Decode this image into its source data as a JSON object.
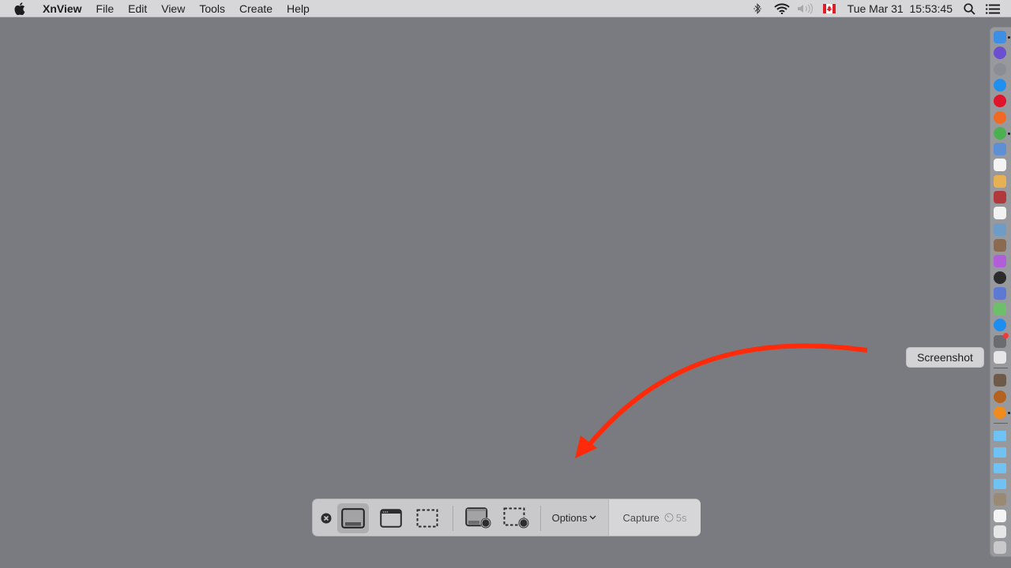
{
  "menubar": {
    "apple_icon": "apple-icon",
    "app_name": "XnView",
    "menus": [
      "File",
      "Edit",
      "View",
      "Tools",
      "Create",
      "Help"
    ],
    "status_icons": [
      "bluetooth-icon",
      "wifi-icon",
      "volume-muted-icon",
      "canada-flag-icon"
    ],
    "clock": "Tue Mar 31  15:53:45",
    "spotlight_icon": "search-icon",
    "notification_icon": "list-icon"
  },
  "dock": {
    "items": [
      {
        "name": "finder",
        "color": "#3d8fe6",
        "running": true
      },
      {
        "name": "siri",
        "color": "#6b4fd1",
        "running": false
      },
      {
        "name": "launchpad",
        "color": "#8a8d93",
        "running": false
      },
      {
        "name": "safari",
        "color": "#1f8ff0",
        "running": false
      },
      {
        "name": "opera",
        "color": "#e0152b",
        "running": false
      },
      {
        "name": "firefox",
        "color": "#f06a23",
        "running": false
      },
      {
        "name": "chrome",
        "color": "#4caf50",
        "running": true
      },
      {
        "name": "preview",
        "color": "#5c8fd4",
        "running": false
      },
      {
        "name": "calendar",
        "color": "#f4f4f4",
        "running": false
      },
      {
        "name": "notes",
        "color": "#e8b055",
        "running": false
      },
      {
        "name": "dictionary",
        "color": "#b0393b",
        "running": false
      },
      {
        "name": "textedit",
        "color": "#f2f2f2",
        "running": false
      },
      {
        "name": "image-capture",
        "color": "#6f9cc7",
        "running": false
      },
      {
        "name": "photo-booth",
        "color": "#8b6a52",
        "running": false
      },
      {
        "name": "affinity-photo",
        "color": "#b05fd8",
        "running": false
      },
      {
        "name": "steam-like",
        "color": "#2b2b2b",
        "running": false
      },
      {
        "name": "bbedit",
        "color": "#5e79d3",
        "running": false
      },
      {
        "name": "maps",
        "color": "#6dbf6a",
        "running": false
      },
      {
        "name": "app-store",
        "color": "#1d8df0",
        "running": false
      },
      {
        "name": "system-preferences",
        "color": "#6c6c70",
        "running": false,
        "badge": true
      },
      {
        "name": "screenshot",
        "color": "#e6e6e6",
        "running": false
      },
      {
        "name": "gimp",
        "color": "#6e5a48",
        "running": false
      },
      {
        "name": "acorn",
        "color": "#b4621f",
        "running": false
      },
      {
        "name": "xnview",
        "color": "#f08b1d",
        "running": true
      },
      {
        "name": "folder-1",
        "color": "#6ec3f4",
        "running": false
      },
      {
        "name": "folder-2",
        "color": "#6ec3f4",
        "running": false
      },
      {
        "name": "folder-3",
        "color": "#6ec3f4",
        "running": false
      },
      {
        "name": "folder-4",
        "color": "#6ec3f4",
        "running": false
      },
      {
        "name": "image-file",
        "color": "#9b8a73",
        "running": false
      },
      {
        "name": "document-file",
        "color": "#f4f4f4",
        "running": false
      },
      {
        "name": "pdf-file",
        "color": "#e6e6e6",
        "running": false
      },
      {
        "name": "trash",
        "color": "#c9c9cb",
        "running": false
      }
    ]
  },
  "tooltip": {
    "text": "Screenshot"
  },
  "annotation": {
    "color": "#ff2a0a"
  },
  "toolbar": {
    "close_icon": "close-circle-icon",
    "modes": [
      {
        "name": "capture-entire-screen",
        "selected": true
      },
      {
        "name": "capture-selected-window",
        "selected": false
      },
      {
        "name": "capture-selected-portion",
        "selected": false
      },
      {
        "name": "record-entire-screen",
        "selected": false
      },
      {
        "name": "record-selected-portion",
        "selected": false
      }
    ],
    "options_label": "Options",
    "capture_label": "Capture",
    "timer_label": "5s"
  }
}
